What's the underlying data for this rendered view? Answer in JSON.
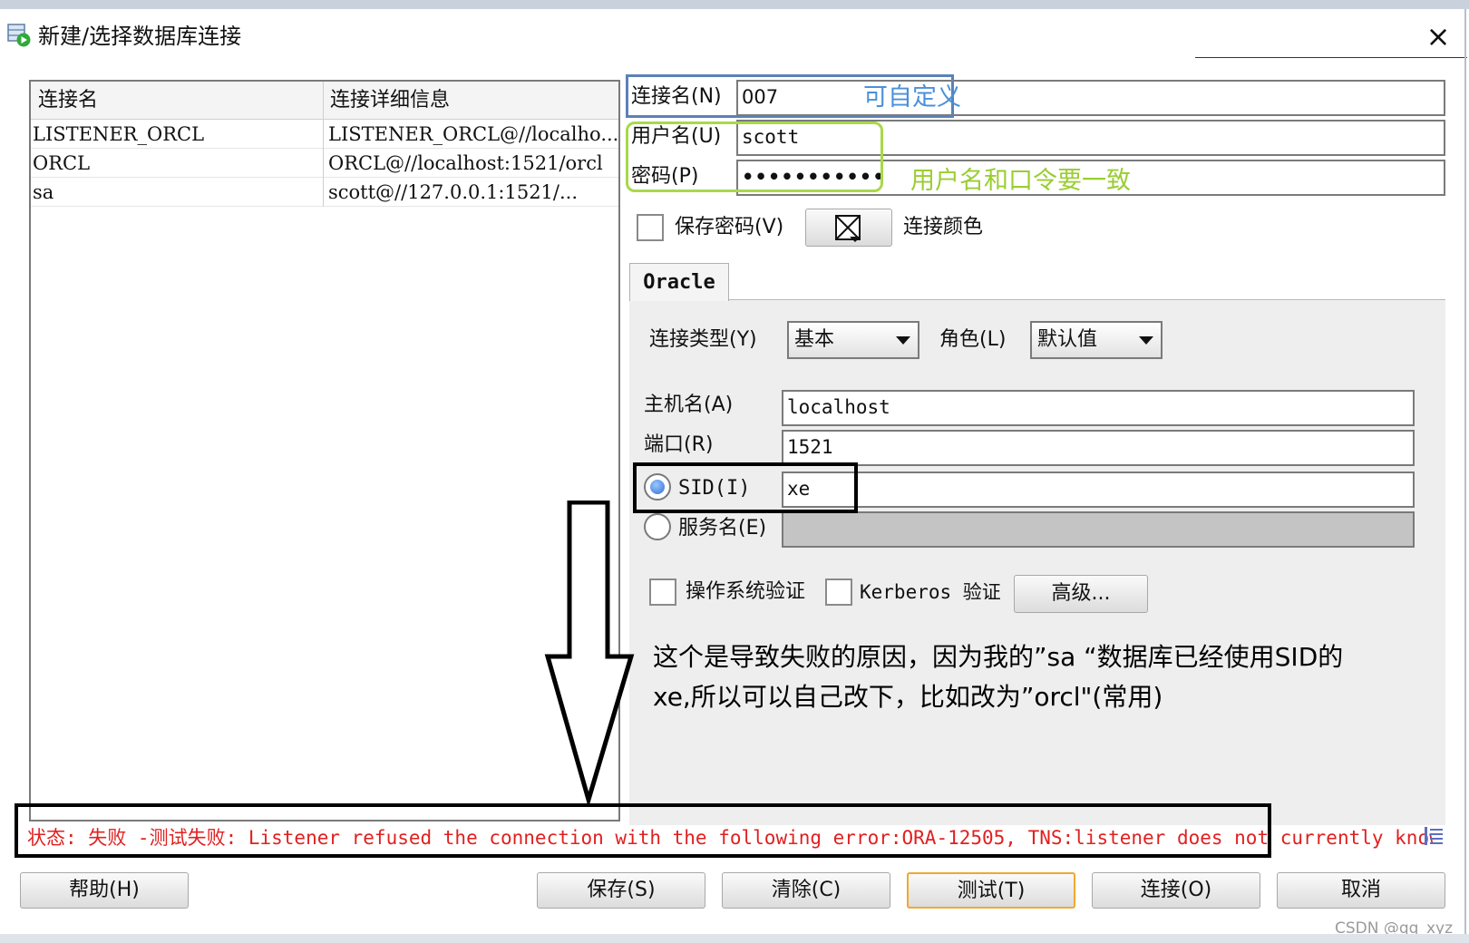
{
  "window": {
    "title": "新建/选择数据库连接",
    "close_glyph": "×",
    "app_icon": "database-connect-icon"
  },
  "connection_list": {
    "columns": [
      "连接名",
      "连接详细信息"
    ],
    "rows": [
      {
        "name": "LISTENER_ORCL",
        "detail": "LISTENER_ORCL@//localho..."
      },
      {
        "name": "ORCL",
        "detail": "ORCL@//localhost:1521/orcl"
      },
      {
        "name": "sa",
        "detail": "scott@//127.0.0.1:1521/..."
      }
    ]
  },
  "form": {
    "conn_name_label": "连接名(N)",
    "conn_name_value": "007",
    "username_label": "用户名(U)",
    "username_value": "scott",
    "password_label": "密码(P)",
    "password_value": "•••••••••••",
    "save_password_label": "保存密码(V)",
    "color_label": "连接颜色",
    "color_icon": "color-picker-icon"
  },
  "tab": {
    "label": "Oracle"
  },
  "oracle": {
    "conn_type_label": "连接类型(Y)",
    "conn_type_value": "基本",
    "role_label": "角色(L)",
    "role_value": "默认值",
    "host_label": "主机名(A)",
    "host_value": "localhost",
    "port_label": "端口(R)",
    "port_value": "1521",
    "sid_label": "SID(I)",
    "sid_value": "xe",
    "service_label": "服务名(E)",
    "os_auth_label": "操作系统验证",
    "kerberos_label": "Kerberos 验证",
    "advanced_label": "高级..."
  },
  "annotations": {
    "custom": "可自定义",
    "consistent": "用户名和口令要一致",
    "reason_line1": "这个是导致失败的原因，因为我的”sa “数据库已经使用SID的",
    "reason_line2": "xe,所以可以自己改下，比如改为”orcl\"(常用)"
  },
  "status": {
    "text": "状态: 失败 -测试失败: Listener refused the connection with the following error:ORA-12505, TNS:listener does not currently know ..",
    "icon": "details-list-icon"
  },
  "buttons": {
    "help": "帮助(H)",
    "save": "保存(S)",
    "clear": "清除(C)",
    "test": "测试(T)",
    "connect": "连接(O)",
    "cancel": "取消"
  },
  "watermark": "CSDN @qq_xyz",
  "colors": {
    "annotation_blue": "#4a90d9",
    "annotation_green": "#9acd32",
    "status_red": "#e02020",
    "focus_orange": "#f0a830"
  }
}
